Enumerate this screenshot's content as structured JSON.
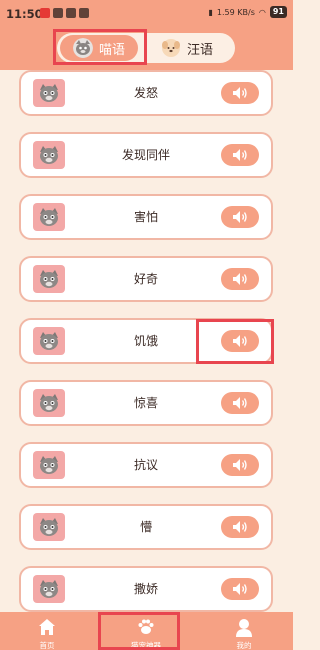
{
  "status": {
    "time": "11:50",
    "network": "1.59 KB/s",
    "battery": "91"
  },
  "tabs": [
    {
      "label": "喵语",
      "icon": "cat-face-icon",
      "active": true
    },
    {
      "label": "汪语",
      "icon": "dog-face-icon",
      "active": false
    }
  ],
  "sounds": [
    {
      "label": "发怒",
      "icon": "cat-face-icon",
      "action": "speaker-icon"
    },
    {
      "label": "发现同伴",
      "icon": "cat-face-icon",
      "action": "speaker-icon"
    },
    {
      "label": "害怕",
      "icon": "cat-face-icon",
      "action": "speaker-icon"
    },
    {
      "label": "好奇",
      "icon": "cat-face-icon",
      "action": "speaker-icon"
    },
    {
      "label": "饥饿",
      "icon": "cat-face-icon",
      "action": "speaker-icon"
    },
    {
      "label": "惊喜",
      "icon": "cat-face-icon",
      "action": "speaker-icon"
    },
    {
      "label": "抗议",
      "icon": "cat-face-icon",
      "action": "speaker-icon"
    },
    {
      "label": "懵",
      "icon": "cat-face-icon",
      "action": "speaker-icon"
    },
    {
      "label": "撒娇",
      "icon": "cat-face-icon",
      "action": "speaker-icon"
    }
  ],
  "nav": [
    {
      "label": "首页",
      "icon": "home-icon"
    },
    {
      "label": "猫宠神器",
      "icon": "paw-icon",
      "active": true
    },
    {
      "label": "我的",
      "icon": "user-icon"
    }
  ],
  "colors": {
    "accent": "#f6a184",
    "background": "#fbeee2",
    "card_border": "#f1b7a5",
    "highlight": "#e8454f"
  }
}
